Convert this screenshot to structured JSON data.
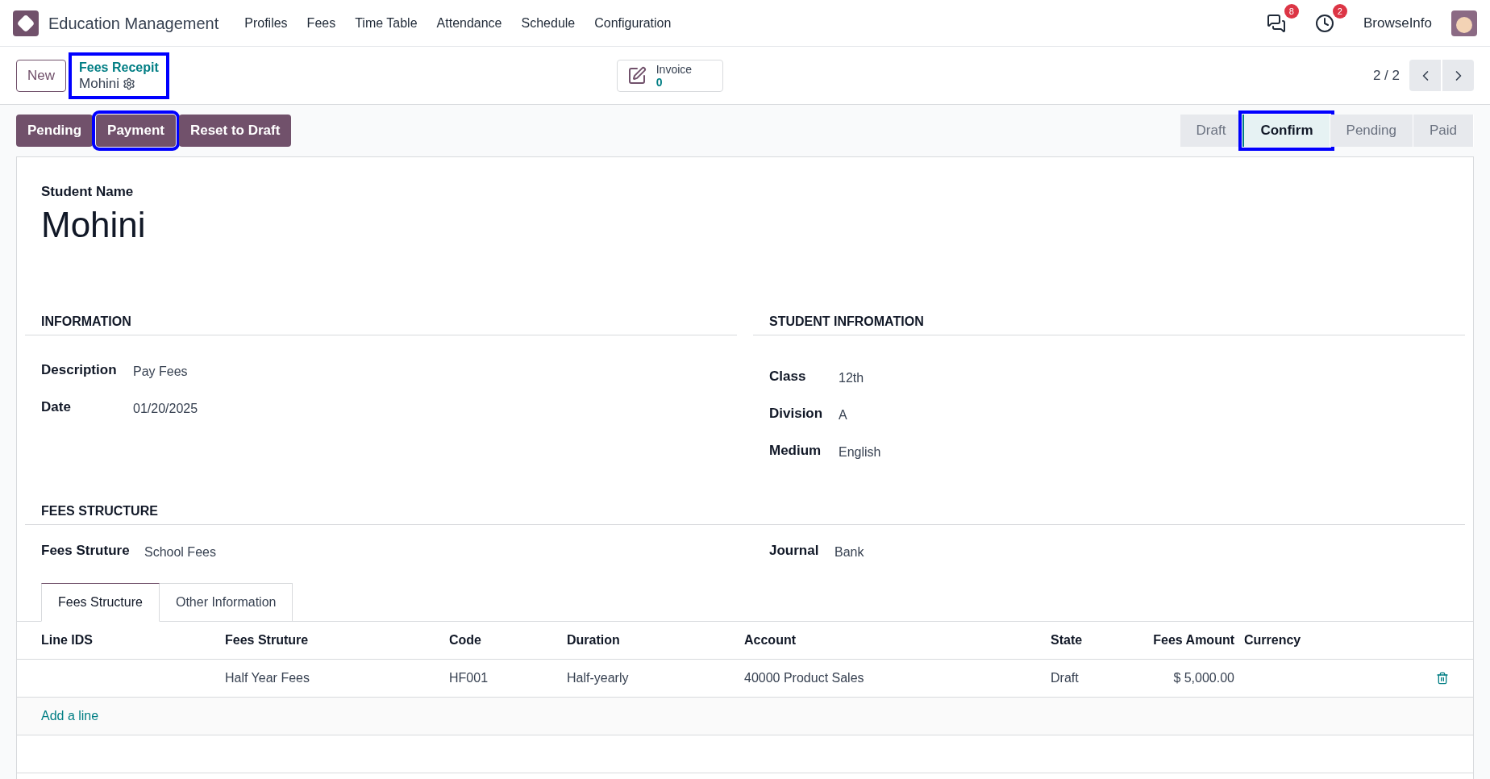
{
  "navbar": {
    "app_name": "Education Management",
    "menu": [
      "Profiles",
      "Fees",
      "Time Table",
      "Attendance",
      "Schedule",
      "Configuration"
    ],
    "messages_count": "8",
    "activities_count": "2",
    "company": "BrowseInfo"
  },
  "control_panel": {
    "new_button": "New",
    "breadcrumb": {
      "parent": "Fees Recepit",
      "current": "Mohini",
      "highlighted": true
    },
    "smart_button": {
      "label": "Invoice",
      "value": "0"
    },
    "pager": "2 / 2"
  },
  "actions": [
    {
      "label": "Pending",
      "highlighted": false
    },
    {
      "label": "Payment",
      "highlighted": true
    },
    {
      "label": "Reset to Draft",
      "highlighted": false
    }
  ],
  "stages": [
    {
      "label": "Draft",
      "selected": false,
      "highlighted": false
    },
    {
      "label": "Confirm",
      "selected": true,
      "highlighted": true
    },
    {
      "label": "Pending",
      "selected": false,
      "highlighted": false
    },
    {
      "label": "Paid",
      "selected": false,
      "highlighted": false
    }
  ],
  "form": {
    "name_label": "Student Name",
    "name": "Mohini",
    "information": {
      "title": "INFORMATION",
      "fields": [
        {
          "label": "Description",
          "value": "Pay Fees"
        },
        {
          "label": "Date",
          "value": "01/20/2025"
        }
      ]
    },
    "student_information": {
      "title": "STUDENT INFROMATION",
      "fields": [
        {
          "label": "Class",
          "value": "12th"
        },
        {
          "label": "Division",
          "value": "A"
        },
        {
          "label": "Medium",
          "value": "English"
        }
      ]
    },
    "fees_structure": {
      "title": "FEES STRUCTURE",
      "left": {
        "label": "Fees Struture",
        "value": "School Fees"
      },
      "right": {
        "label": "Journal",
        "value": "Bank"
      }
    },
    "tabs": [
      {
        "label": "Fees Structure",
        "selected": true
      },
      {
        "label": "Other Information",
        "selected": false
      }
    ],
    "table": {
      "columns": [
        "Line IDS",
        "Fees Struture",
        "Code",
        "Duration",
        "Account",
        "State",
        "Fees Amount",
        "Currency"
      ],
      "rows": [
        {
          "cells": [
            "",
            "Half Year Fees",
            "HF001",
            "Half-yearly",
            "40000 Product Sales",
            "Draft",
            "$ 5,000.00",
            ""
          ]
        }
      ],
      "add_line": "Add a line"
    }
  }
}
